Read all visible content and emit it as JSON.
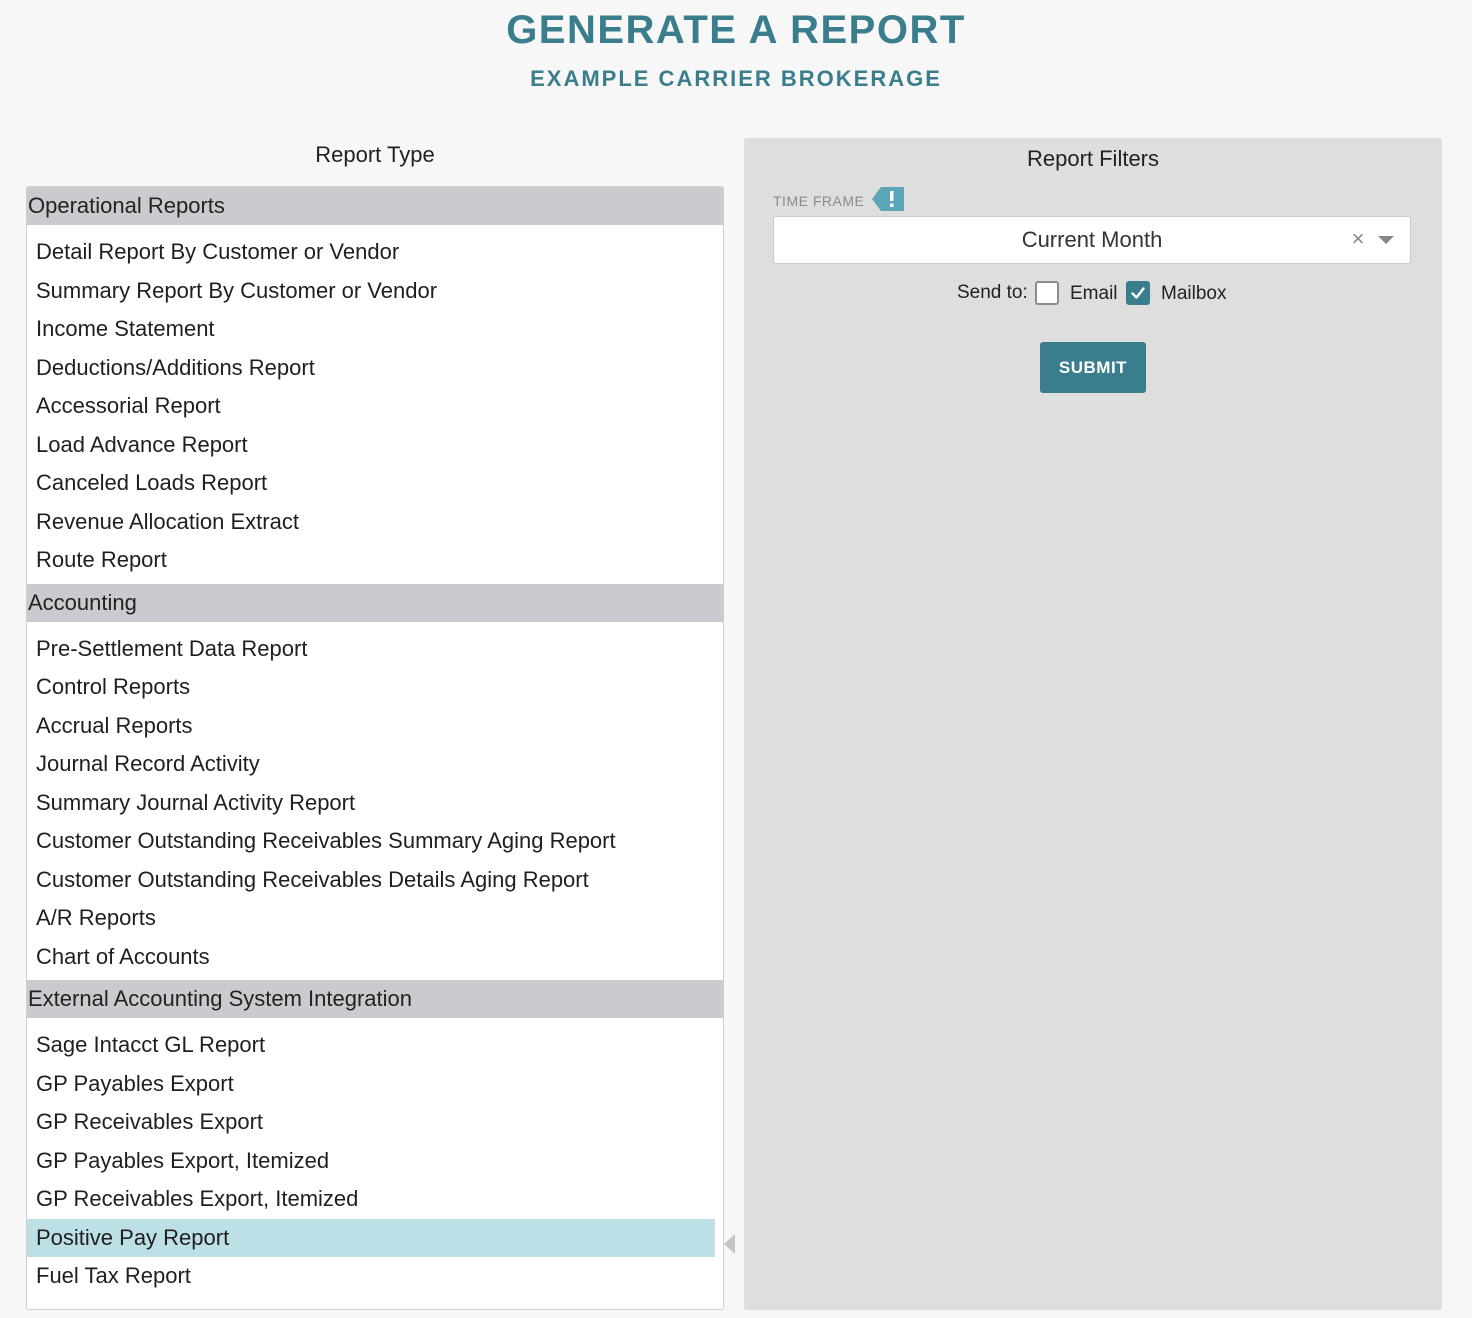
{
  "page": {
    "title": "GENERATE A REPORT",
    "subtitle": "EXAMPLE CARRIER BROKERAGE"
  },
  "report_type": {
    "heading": "Report Type",
    "selected": "Positive Pay Report",
    "groups": [
      {
        "name": "Operational Reports",
        "items": [
          "Detail Report By Customer or Vendor",
          "Summary Report By Customer or Vendor",
          "Income Statement",
          "Deductions/Additions Report",
          "Accessorial Report",
          "Load Advance Report",
          "Canceled Loads Report",
          "Revenue Allocation Extract",
          "Route Report"
        ]
      },
      {
        "name": "Accounting",
        "items": [
          "Pre-Settlement Data Report",
          "Control Reports",
          "Accrual Reports",
          "Journal Record Activity",
          "Summary Journal Activity Report",
          "Customer Outstanding Receivables Summary Aging Report",
          "Customer Outstanding Receivables Details Aging Report",
          "A/R Reports",
          "Chart of Accounts"
        ]
      },
      {
        "name": "External Accounting System Integration",
        "items": [
          "Sage Intacct GL Report",
          "GP Payables Export",
          "GP Receivables Export",
          "GP Payables Export, Itemized",
          "GP Receivables Export, Itemized",
          "Positive Pay Report",
          "Fuel Tax Report"
        ]
      }
    ]
  },
  "filters": {
    "heading": "Report Filters",
    "time_frame": {
      "label": "TIME FRAME",
      "required_icon": "exclamation-icon",
      "value": "Current Month",
      "clear_glyph": "×"
    },
    "send_to": {
      "label": "Send to:",
      "email": {
        "label": "Email",
        "checked": false
      },
      "mailbox": {
        "label": "Mailbox",
        "checked": true
      }
    },
    "submit_label": "SUBMIT"
  },
  "colors": {
    "accent": "#3a7d8c",
    "badge": "#5aa6b8",
    "selected_row": "#bde0e6",
    "group_header": "#cbcbcf",
    "panel": "#dfdedf"
  }
}
